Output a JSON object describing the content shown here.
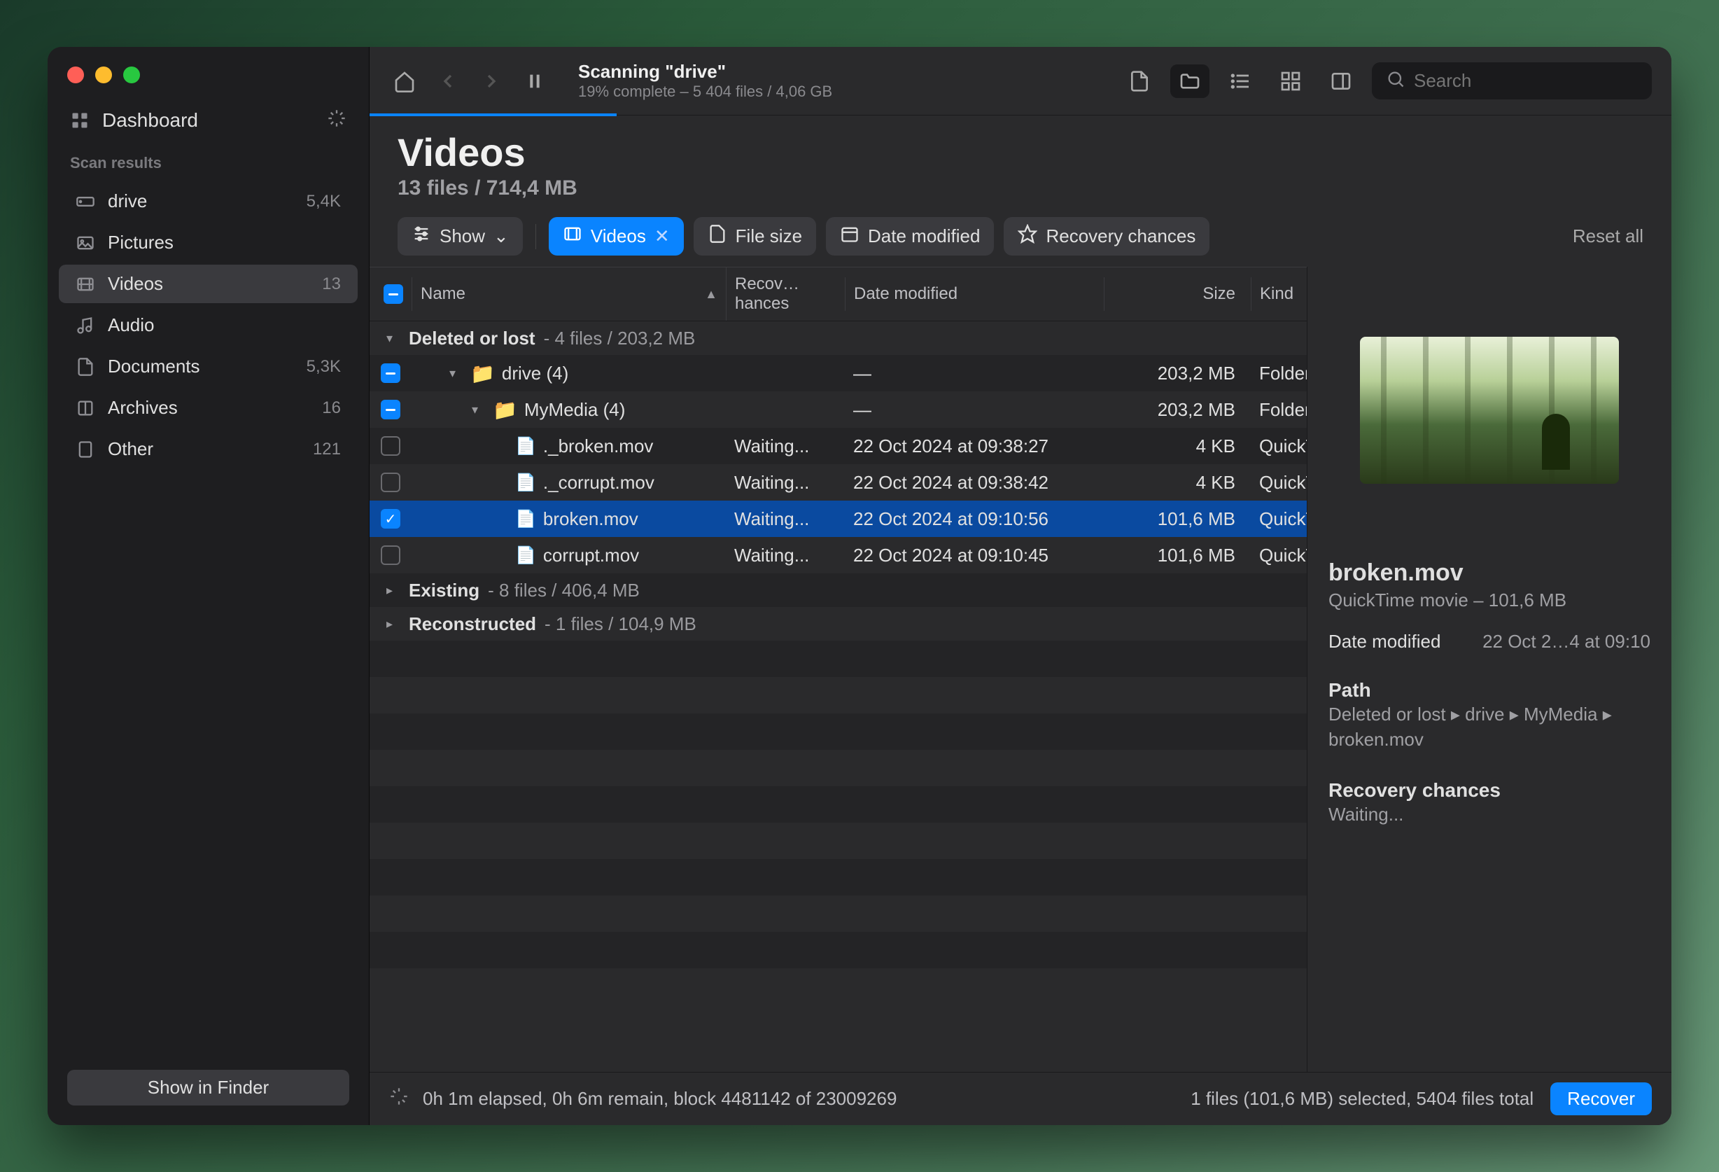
{
  "sidebar": {
    "dashboard": "Dashboard",
    "scan_results_header": "Scan results",
    "items": [
      {
        "label": "drive",
        "count": "5,4K"
      },
      {
        "label": "Pictures",
        "count": ""
      },
      {
        "label": "Videos",
        "count": "13"
      },
      {
        "label": "Audio",
        "count": ""
      },
      {
        "label": "Documents",
        "count": "5,3K"
      },
      {
        "label": "Archives",
        "count": "16"
      },
      {
        "label": "Other",
        "count": "121"
      }
    ],
    "show_in_finder": "Show in Finder"
  },
  "toolbar": {
    "scan_title": "Scanning \"drive\"",
    "scan_sub": "19% complete – 5 404 files / 4,06 GB",
    "search_placeholder": "Search"
  },
  "header": {
    "title": "Videos",
    "subtitle": "13 files / 714,4 MB"
  },
  "filters": {
    "show": "Show",
    "videos": "Videos",
    "file_size": "File size",
    "date_modified": "Date modified",
    "recovery_chances": "Recovery chances",
    "reset_all": "Reset all"
  },
  "columns": {
    "name": "Name",
    "recovery": "Recov…hances",
    "date": "Date modified",
    "size": "Size",
    "kind": "Kind"
  },
  "sections": [
    {
      "name": "Deleted or lost",
      "info": "- 4 files / 203,2 MB",
      "open": true
    },
    {
      "name": "Existing",
      "info": "- 8 files / 406,4 MB",
      "open": false
    },
    {
      "name": "Reconstructed",
      "info": "- 1 files / 104,9 MB",
      "open": false
    }
  ],
  "rows": [
    {
      "indent": 1,
      "check": "indet",
      "folder": true,
      "name": "drive (4)",
      "rec": "",
      "date": "—",
      "size": "203,2 MB",
      "kind": "Folder"
    },
    {
      "indent": 2,
      "check": "indet",
      "folder": true,
      "name": "MyMedia (4)",
      "rec": "",
      "date": "—",
      "size": "203,2 MB",
      "kind": "Folder"
    },
    {
      "indent": 3,
      "check": "",
      "folder": false,
      "name": "._broken.mov",
      "rec": "Waiting...",
      "date": "22 Oct 2024 at 09:38:27",
      "size": "4 KB",
      "kind": "QuickTim"
    },
    {
      "indent": 3,
      "check": "",
      "folder": false,
      "name": "._corrupt.mov",
      "rec": "Waiting...",
      "date": "22 Oct 2024 at 09:38:42",
      "size": "4 KB",
      "kind": "QuickTim"
    },
    {
      "indent": 3,
      "check": "checked",
      "folder": false,
      "name": "broken.mov",
      "rec": "Waiting...",
      "date": "22 Oct 2024 at 09:10:56",
      "size": "101,6 MB",
      "kind": "QuickTim",
      "sel": true
    },
    {
      "indent": 3,
      "check": "",
      "folder": false,
      "name": "corrupt.mov",
      "rec": "Waiting...",
      "date": "22 Oct 2024 at 09:10:45",
      "size": "101,6 MB",
      "kind": "QuickTim"
    }
  ],
  "details": {
    "title": "broken.mov",
    "subtitle": "QuickTime movie – 101,6 MB",
    "date_label": "Date modified",
    "date_value": "22 Oct 2…4 at 09:10",
    "path_label": "Path",
    "path_value": "Deleted or lost ▸ drive ▸ MyMedia ▸ broken.mov",
    "recovery_label": "Recovery chances",
    "recovery_value": "Waiting..."
  },
  "status": {
    "elapsed": "0h 1m elapsed, 0h 6m remain, block 4481142 of 23009269",
    "selection": "1 files (101,6 MB) selected, 5404 files total",
    "recover": "Recover"
  }
}
